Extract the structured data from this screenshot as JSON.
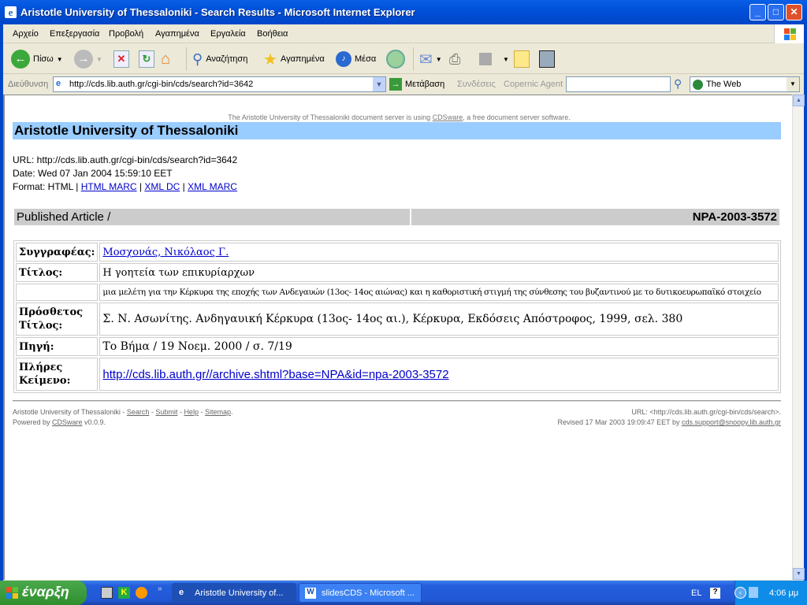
{
  "window": {
    "title": "Aristotle University of Thessaloniki - Search Results - Microsoft Internet Explorer"
  },
  "menu": [
    "Αρχείο",
    "Επεξεργασία",
    "Προβολή",
    "Αγαπημένα",
    "Εργαλεία",
    "Βοήθεια"
  ],
  "toolbar": {
    "back": "Πίσω",
    "search": "Αναζήτηση",
    "favorites": "Αγαπημένα",
    "media": "Μέσα"
  },
  "addressbar": {
    "label": "Διεύθυνση",
    "url": "http://cds.lib.auth.gr/cgi-bin/cds/search?id=3642",
    "go": "Μετάβαση",
    "links": "Συνδέσεις",
    "copernic": "Copernic Agent",
    "search_value": "",
    "engine": "The Web"
  },
  "page": {
    "powered_prefix": "The Aristotle University of Thessaloniki document server is using ",
    "powered_link": "CDSware",
    "powered_suffix": ", a free document server software.",
    "header": "Aristotle University of Thessaloniki",
    "url_line": "URL: http://cds.lib.auth.gr/cgi-bin/cds/search?id=3642",
    "date_line": "Date: Wed 07 Jan 2004 15:59:10 EET",
    "format_label": "Format: HTML | ",
    "formats": [
      "HTML MARC",
      "XML DC",
      "XML MARC"
    ],
    "sep": " | ",
    "collection": "Published Article /",
    "record_id": "NPA-2003-3572",
    "record": {
      "author_label": "Συγγραφέας:",
      "author": "Μοσχονάς, Νικόλαος Γ.",
      "title_label": "Τίτλος:",
      "title": "Η γοητεία των επικυρίαρχων",
      "subtitle": "μια μελέτη για την Κέρκυρα της εποχής των Ανδεγαυών (13ος- 14ος αιώνας) και η καθοριστική στιγμή της σύνθεσης του βυζαντινού με το δυτικοευρωπαϊκό στοιχείο",
      "added_title_label": "Πρόσθετος Τίτλος:",
      "added_title": "Σ. Ν. Ασωνίτης. Ανδηγαυική Κέρκυρα (13ος- 14ος αι.), Κέρκυρα, Εκδόσεις Απόστροφος, 1999, σελ. 380",
      "source_label": "Πηγή:",
      "source": "Το Βήμα / 19 Νοεμ. 2000 / σ. 7/19",
      "fulltext_label": "Πλήρες Κείμενο:",
      "fulltext": "http://cds.lib.auth.gr//archive.shtml?base=NPA&id=npa-2003-3572"
    },
    "footer": {
      "org": "Aristotle University of Thessaloniki - ",
      "links": [
        "Search",
        "Submit",
        "Help",
        "Sitemap"
      ],
      "powered": "Powered by ",
      "cdsware": "CDSware",
      "version": " v0.0.9.",
      "url": "URL: <http://cds.lib.auth.gr/cgi-bin/cds/search>.",
      "revised": "Revised 17 Mar 2003 19:09:47 EET by ",
      "email": "cds.support@snoopy.lib.auth.gr"
    }
  },
  "taskbar": {
    "start": "έναρξη",
    "tasks": [
      "Aristotle University of...",
      "slidesCDS - Microsoft ..."
    ],
    "lang": "EL",
    "time": "4:06 μμ"
  }
}
